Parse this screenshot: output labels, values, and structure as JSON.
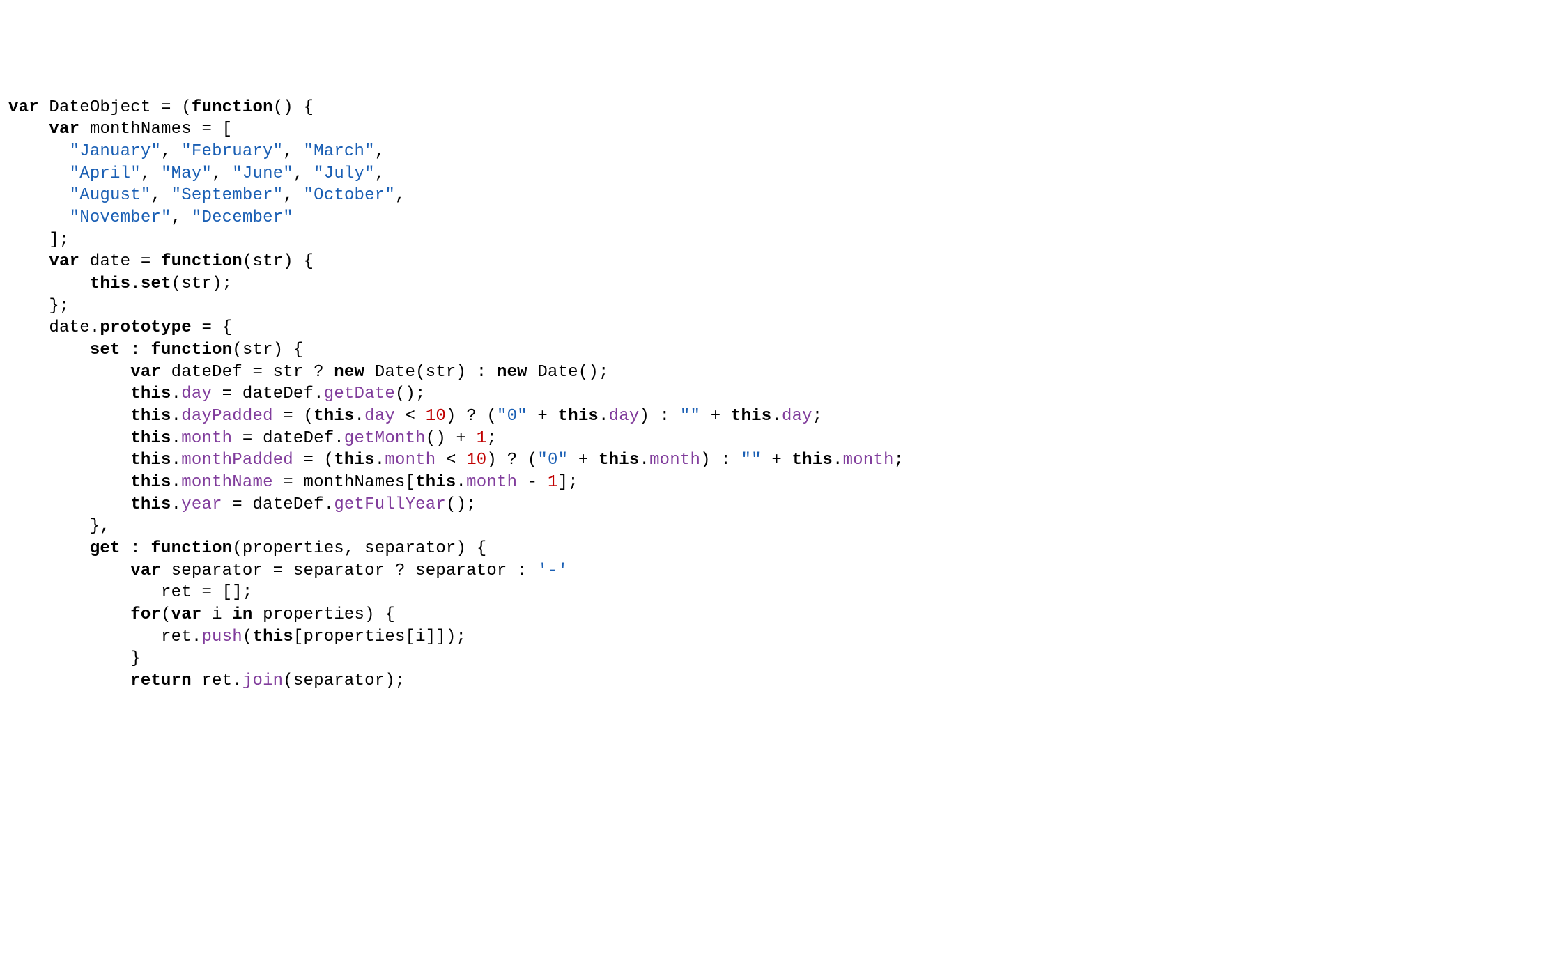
{
  "tokens": [
    {
      "t": "var",
      "c": "kw"
    },
    {
      "t": " DateObject = (",
      "c": "ident"
    },
    {
      "t": "function",
      "c": "kw"
    },
    {
      "t": "() {",
      "c": "ident"
    },
    {
      "t": "\n",
      "c": ""
    },
    {
      "t": "    ",
      "c": ""
    },
    {
      "t": "var",
      "c": "kw"
    },
    {
      "t": " monthNames = [",
      "c": "ident"
    },
    {
      "t": "\n",
      "c": ""
    },
    {
      "t": "      ",
      "c": ""
    },
    {
      "t": "\"January\"",
      "c": "str"
    },
    {
      "t": ", ",
      "c": "ident"
    },
    {
      "t": "\"February\"",
      "c": "str"
    },
    {
      "t": ", ",
      "c": "ident"
    },
    {
      "t": "\"March\"",
      "c": "str"
    },
    {
      "t": ",",
      "c": "ident"
    },
    {
      "t": "\n",
      "c": ""
    },
    {
      "t": "      ",
      "c": ""
    },
    {
      "t": "\"April\"",
      "c": "str"
    },
    {
      "t": ", ",
      "c": "ident"
    },
    {
      "t": "\"May\"",
      "c": "str"
    },
    {
      "t": ", ",
      "c": "ident"
    },
    {
      "t": "\"June\"",
      "c": "str"
    },
    {
      "t": ", ",
      "c": "ident"
    },
    {
      "t": "\"July\"",
      "c": "str"
    },
    {
      "t": ",",
      "c": "ident"
    },
    {
      "t": "\n",
      "c": ""
    },
    {
      "t": "      ",
      "c": ""
    },
    {
      "t": "\"August\"",
      "c": "str"
    },
    {
      "t": ", ",
      "c": "ident"
    },
    {
      "t": "\"September\"",
      "c": "str"
    },
    {
      "t": ", ",
      "c": "ident"
    },
    {
      "t": "\"October\"",
      "c": "str"
    },
    {
      "t": ",",
      "c": "ident"
    },
    {
      "t": "\n",
      "c": ""
    },
    {
      "t": "      ",
      "c": ""
    },
    {
      "t": "\"November\"",
      "c": "str"
    },
    {
      "t": ", ",
      "c": "ident"
    },
    {
      "t": "\"December\"",
      "c": "str"
    },
    {
      "t": "\n",
      "c": ""
    },
    {
      "t": "    ];",
      "c": "ident"
    },
    {
      "t": "\n",
      "c": ""
    },
    {
      "t": "    ",
      "c": ""
    },
    {
      "t": "var",
      "c": "kw"
    },
    {
      "t": " date = ",
      "c": "ident"
    },
    {
      "t": "function",
      "c": "kw"
    },
    {
      "t": "(str) {",
      "c": "ident"
    },
    {
      "t": "\n",
      "c": ""
    },
    {
      "t": "        ",
      "c": ""
    },
    {
      "t": "this",
      "c": "this"
    },
    {
      "t": ".",
      "c": "ident"
    },
    {
      "t": "set",
      "c": "fn"
    },
    {
      "t": "(str);",
      "c": "ident"
    },
    {
      "t": "\n",
      "c": ""
    },
    {
      "t": "    };",
      "c": "ident"
    },
    {
      "t": "\n",
      "c": ""
    },
    {
      "t": "    date.",
      "c": "ident"
    },
    {
      "t": "prototype",
      "c": "fn"
    },
    {
      "t": " = {",
      "c": "ident"
    },
    {
      "t": "\n",
      "c": ""
    },
    {
      "t": "        ",
      "c": ""
    },
    {
      "t": "set",
      "c": "fn"
    },
    {
      "t": " : ",
      "c": "ident"
    },
    {
      "t": "function",
      "c": "kw"
    },
    {
      "t": "(str) {",
      "c": "ident"
    },
    {
      "t": "\n",
      "c": ""
    },
    {
      "t": "            ",
      "c": ""
    },
    {
      "t": "var",
      "c": "kw"
    },
    {
      "t": " dateDef = str ? ",
      "c": "ident"
    },
    {
      "t": "new",
      "c": "kw"
    },
    {
      "t": " Date(str) : ",
      "c": "ident"
    },
    {
      "t": "new",
      "c": "kw"
    },
    {
      "t": " Date();",
      "c": "ident"
    },
    {
      "t": "\n",
      "c": ""
    },
    {
      "t": "            ",
      "c": ""
    },
    {
      "t": "this",
      "c": "this"
    },
    {
      "t": ".",
      "c": "ident"
    },
    {
      "t": "day",
      "c": "prop"
    },
    {
      "t": " = dateDef.",
      "c": "ident"
    },
    {
      "t": "getDate",
      "c": "method"
    },
    {
      "t": "();",
      "c": "ident"
    },
    {
      "t": "\n",
      "c": ""
    },
    {
      "t": "            ",
      "c": ""
    },
    {
      "t": "this",
      "c": "this"
    },
    {
      "t": ".",
      "c": "ident"
    },
    {
      "t": "dayPadded",
      "c": "prop"
    },
    {
      "t": " = (",
      "c": "ident"
    },
    {
      "t": "this",
      "c": "this"
    },
    {
      "t": ".",
      "c": "ident"
    },
    {
      "t": "day",
      "c": "prop"
    },
    {
      "t": " < ",
      "c": "ident"
    },
    {
      "t": "10",
      "c": "num"
    },
    {
      "t": ") ? (",
      "c": "ident"
    },
    {
      "t": "\"0\"",
      "c": "str"
    },
    {
      "t": " + ",
      "c": "ident"
    },
    {
      "t": "this",
      "c": "this"
    },
    {
      "t": ".",
      "c": "ident"
    },
    {
      "t": "day",
      "c": "prop"
    },
    {
      "t": ") : ",
      "c": "ident"
    },
    {
      "t": "\"\"",
      "c": "str"
    },
    {
      "t": " + ",
      "c": "ident"
    },
    {
      "t": "this",
      "c": "this"
    },
    {
      "t": ".",
      "c": "ident"
    },
    {
      "t": "day",
      "c": "prop"
    },
    {
      "t": ";",
      "c": "ident"
    },
    {
      "t": "\n",
      "c": ""
    },
    {
      "t": "            ",
      "c": ""
    },
    {
      "t": "this",
      "c": "this"
    },
    {
      "t": ".",
      "c": "ident"
    },
    {
      "t": "month",
      "c": "prop"
    },
    {
      "t": " = dateDef.",
      "c": "ident"
    },
    {
      "t": "getMonth",
      "c": "method"
    },
    {
      "t": "() + ",
      "c": "ident"
    },
    {
      "t": "1",
      "c": "num"
    },
    {
      "t": ";",
      "c": "ident"
    },
    {
      "t": "\n",
      "c": ""
    },
    {
      "t": "            ",
      "c": ""
    },
    {
      "t": "this",
      "c": "this"
    },
    {
      "t": ".",
      "c": "ident"
    },
    {
      "t": "monthPadded",
      "c": "prop"
    },
    {
      "t": " = (",
      "c": "ident"
    },
    {
      "t": "this",
      "c": "this"
    },
    {
      "t": ".",
      "c": "ident"
    },
    {
      "t": "month",
      "c": "prop"
    },
    {
      "t": " < ",
      "c": "ident"
    },
    {
      "t": "10",
      "c": "num"
    },
    {
      "t": ") ? (",
      "c": "ident"
    },
    {
      "t": "\"0\"",
      "c": "str"
    },
    {
      "t": " + ",
      "c": "ident"
    },
    {
      "t": "this",
      "c": "this"
    },
    {
      "t": ".",
      "c": "ident"
    },
    {
      "t": "month",
      "c": "prop"
    },
    {
      "t": ") : ",
      "c": "ident"
    },
    {
      "t": "\"\"",
      "c": "str"
    },
    {
      "t": " + ",
      "c": "ident"
    },
    {
      "t": "this",
      "c": "this"
    },
    {
      "t": ".",
      "c": "ident"
    },
    {
      "t": "month",
      "c": "prop"
    },
    {
      "t": ";",
      "c": "ident"
    },
    {
      "t": "\n",
      "c": ""
    },
    {
      "t": "            ",
      "c": ""
    },
    {
      "t": "this",
      "c": "this"
    },
    {
      "t": ".",
      "c": "ident"
    },
    {
      "t": "monthName",
      "c": "prop"
    },
    {
      "t": " = monthNames[",
      "c": "ident"
    },
    {
      "t": "this",
      "c": "this"
    },
    {
      "t": ".",
      "c": "ident"
    },
    {
      "t": "month",
      "c": "prop"
    },
    {
      "t": " - ",
      "c": "ident"
    },
    {
      "t": "1",
      "c": "num"
    },
    {
      "t": "];",
      "c": "ident"
    },
    {
      "t": "\n",
      "c": ""
    },
    {
      "t": "            ",
      "c": ""
    },
    {
      "t": "this",
      "c": "this"
    },
    {
      "t": ".",
      "c": "ident"
    },
    {
      "t": "year",
      "c": "prop"
    },
    {
      "t": " = dateDef.",
      "c": "ident"
    },
    {
      "t": "getFullYear",
      "c": "method"
    },
    {
      "t": "();",
      "c": "ident"
    },
    {
      "t": "\n",
      "c": ""
    },
    {
      "t": "        },",
      "c": "ident"
    },
    {
      "t": "\n",
      "c": ""
    },
    {
      "t": "        ",
      "c": ""
    },
    {
      "t": "get",
      "c": "fn"
    },
    {
      "t": " : ",
      "c": "ident"
    },
    {
      "t": "function",
      "c": "kw"
    },
    {
      "t": "(properties, separator) {",
      "c": "ident"
    },
    {
      "t": "\n",
      "c": ""
    },
    {
      "t": "            ",
      "c": ""
    },
    {
      "t": "var",
      "c": "kw"
    },
    {
      "t": " separator = separator ? separator : ",
      "c": "ident"
    },
    {
      "t": "'-'",
      "c": "str"
    },
    {
      "t": "\n",
      "c": ""
    },
    {
      "t": "               ret = [];",
      "c": "ident"
    },
    {
      "t": "\n",
      "c": ""
    },
    {
      "t": "            ",
      "c": ""
    },
    {
      "t": "for",
      "c": "kw"
    },
    {
      "t": "(",
      "c": "ident"
    },
    {
      "t": "var",
      "c": "kw"
    },
    {
      "t": " i ",
      "c": "ident"
    },
    {
      "t": "in",
      "c": "kw"
    },
    {
      "t": " properties) {",
      "c": "ident"
    },
    {
      "t": "\n",
      "c": ""
    },
    {
      "t": "               ret.",
      "c": "ident"
    },
    {
      "t": "push",
      "c": "method"
    },
    {
      "t": "(",
      "c": "ident"
    },
    {
      "t": "this",
      "c": "this"
    },
    {
      "t": "[properties[i]]);",
      "c": "ident"
    },
    {
      "t": "\n",
      "c": ""
    },
    {
      "t": "            }",
      "c": "ident"
    },
    {
      "t": "\n",
      "c": ""
    },
    {
      "t": "            ",
      "c": ""
    },
    {
      "t": "return",
      "c": "kw"
    },
    {
      "t": " ret.",
      "c": "ident"
    },
    {
      "t": "join",
      "c": "method"
    },
    {
      "t": "(separator);",
      "c": "ident"
    }
  ]
}
